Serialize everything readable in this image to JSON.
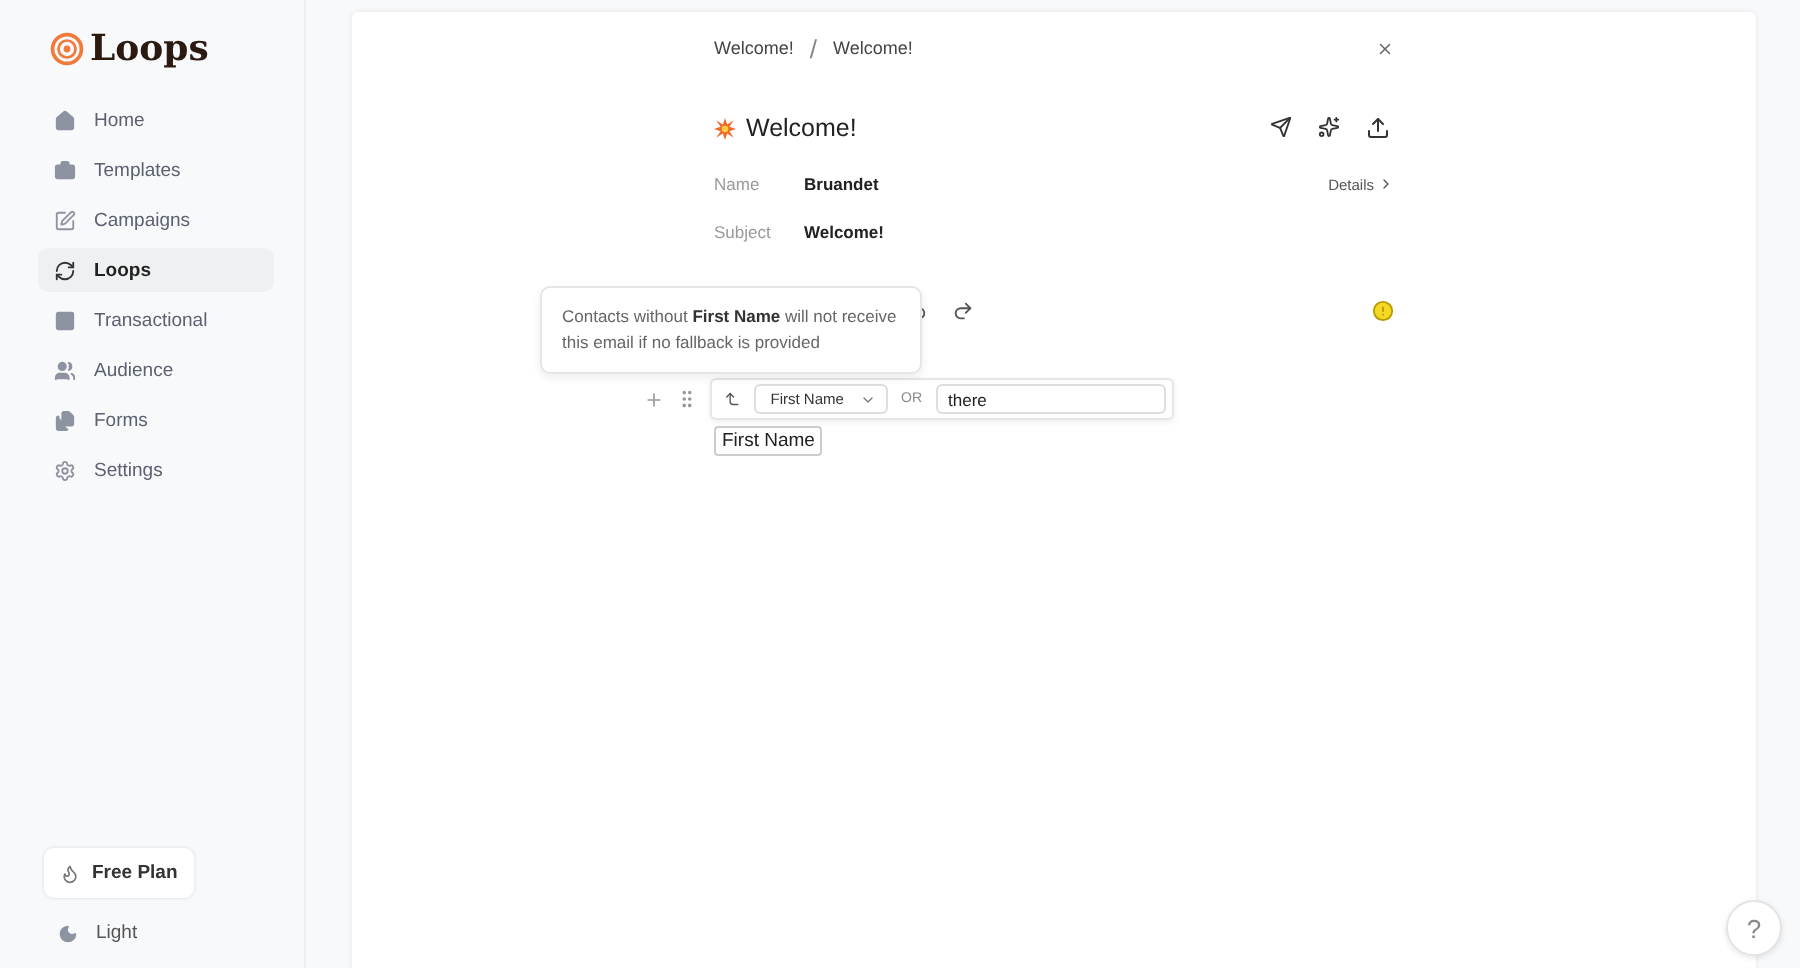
{
  "sidebar": {
    "logo": "Loops",
    "items": [
      {
        "label": "Home",
        "selected": false
      },
      {
        "label": "Templates",
        "selected": false
      },
      {
        "label": "Campaigns",
        "selected": false
      },
      {
        "label": "Loops",
        "selected": true
      },
      {
        "label": "Transactional",
        "selected": false
      },
      {
        "label": "Audience",
        "selected": false
      },
      {
        "label": "Forms",
        "selected": false
      },
      {
        "label": "Settings",
        "selected": false
      }
    ],
    "plan_button": "Free Plan",
    "theme_toggle": "Light"
  },
  "breadcrumb": [
    "Welcome!",
    "Welcome!"
  ],
  "breadcrumb_separator": "/",
  "email": {
    "title": "Welcome!",
    "fields": [
      {
        "label": "Name",
        "value": "Bruandet"
      },
      {
        "label": "Subject",
        "value": "Welcome!"
      }
    ],
    "details_link": "Details"
  },
  "tooltip": "Contacts without **First Name** will not receive this email if no fallback is provided",
  "merge_tag_editor": {
    "property": "First Name",
    "separator": "OR",
    "fallback": "there"
  },
  "merge_tag": "First Name",
  "help_button": "?"
}
